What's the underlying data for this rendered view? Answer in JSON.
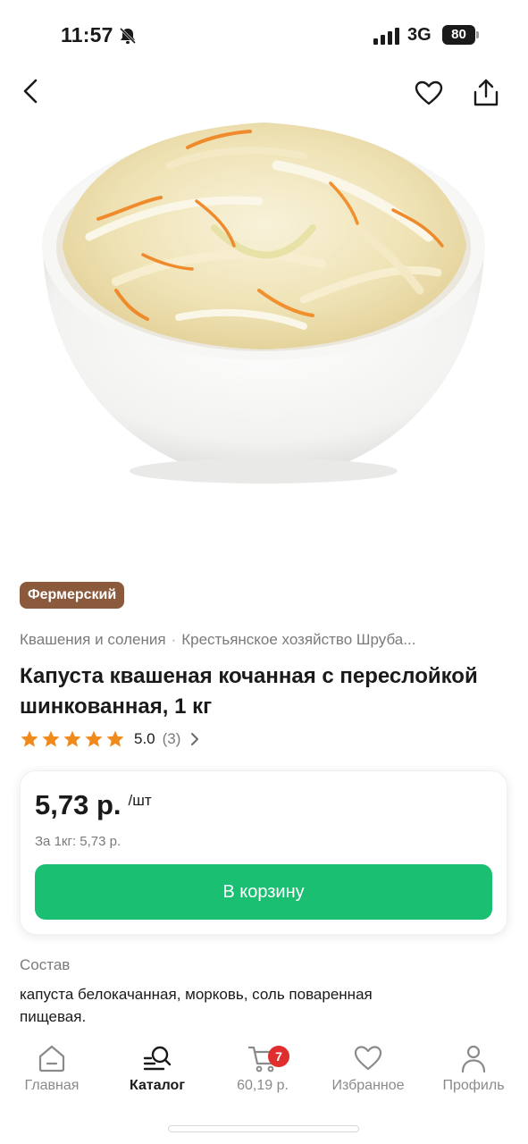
{
  "status_bar": {
    "time": "11:57",
    "network": "3G",
    "battery": "80"
  },
  "product": {
    "badge": "Фермерский",
    "category": "Квашения и соления",
    "separator": "·",
    "producer": "Крестьянское хозяйство Шруба...",
    "title": "Капуста квашеная кочанная с переслойкой шинкованная, 1 кг",
    "rating_value": "5.0",
    "rating_count": "(3)",
    "stars": 5,
    "price": "5,73 р.",
    "price_unit": "/шт",
    "unit_price": "За 1кг: 5,73 р.",
    "add_to_cart_label": "В корзину",
    "composition_label": "Состав",
    "composition_text": "капуста белокачанная, морковь, соль поваренная пищевая."
  },
  "tab_bar": {
    "home_label": "Главная",
    "catalog_label": "Каталог",
    "cart_label": "60,19 р.",
    "cart_count": "7",
    "favorites_label": "Избранное",
    "profile_label": "Профиль"
  },
  "colors": {
    "accent_green": "#1bbf72",
    "badge_brown": "#8b5a3c",
    "star_orange": "#f08a1c",
    "cart_badge_red": "#e02d2d"
  },
  "icons": [
    "mute-icon",
    "signal-icon",
    "back-arrow-icon",
    "heart-icon",
    "share-icon",
    "star-icon",
    "chevron-right-icon",
    "home-icon",
    "catalog-search-icon",
    "cart-icon",
    "profile-icon"
  ]
}
